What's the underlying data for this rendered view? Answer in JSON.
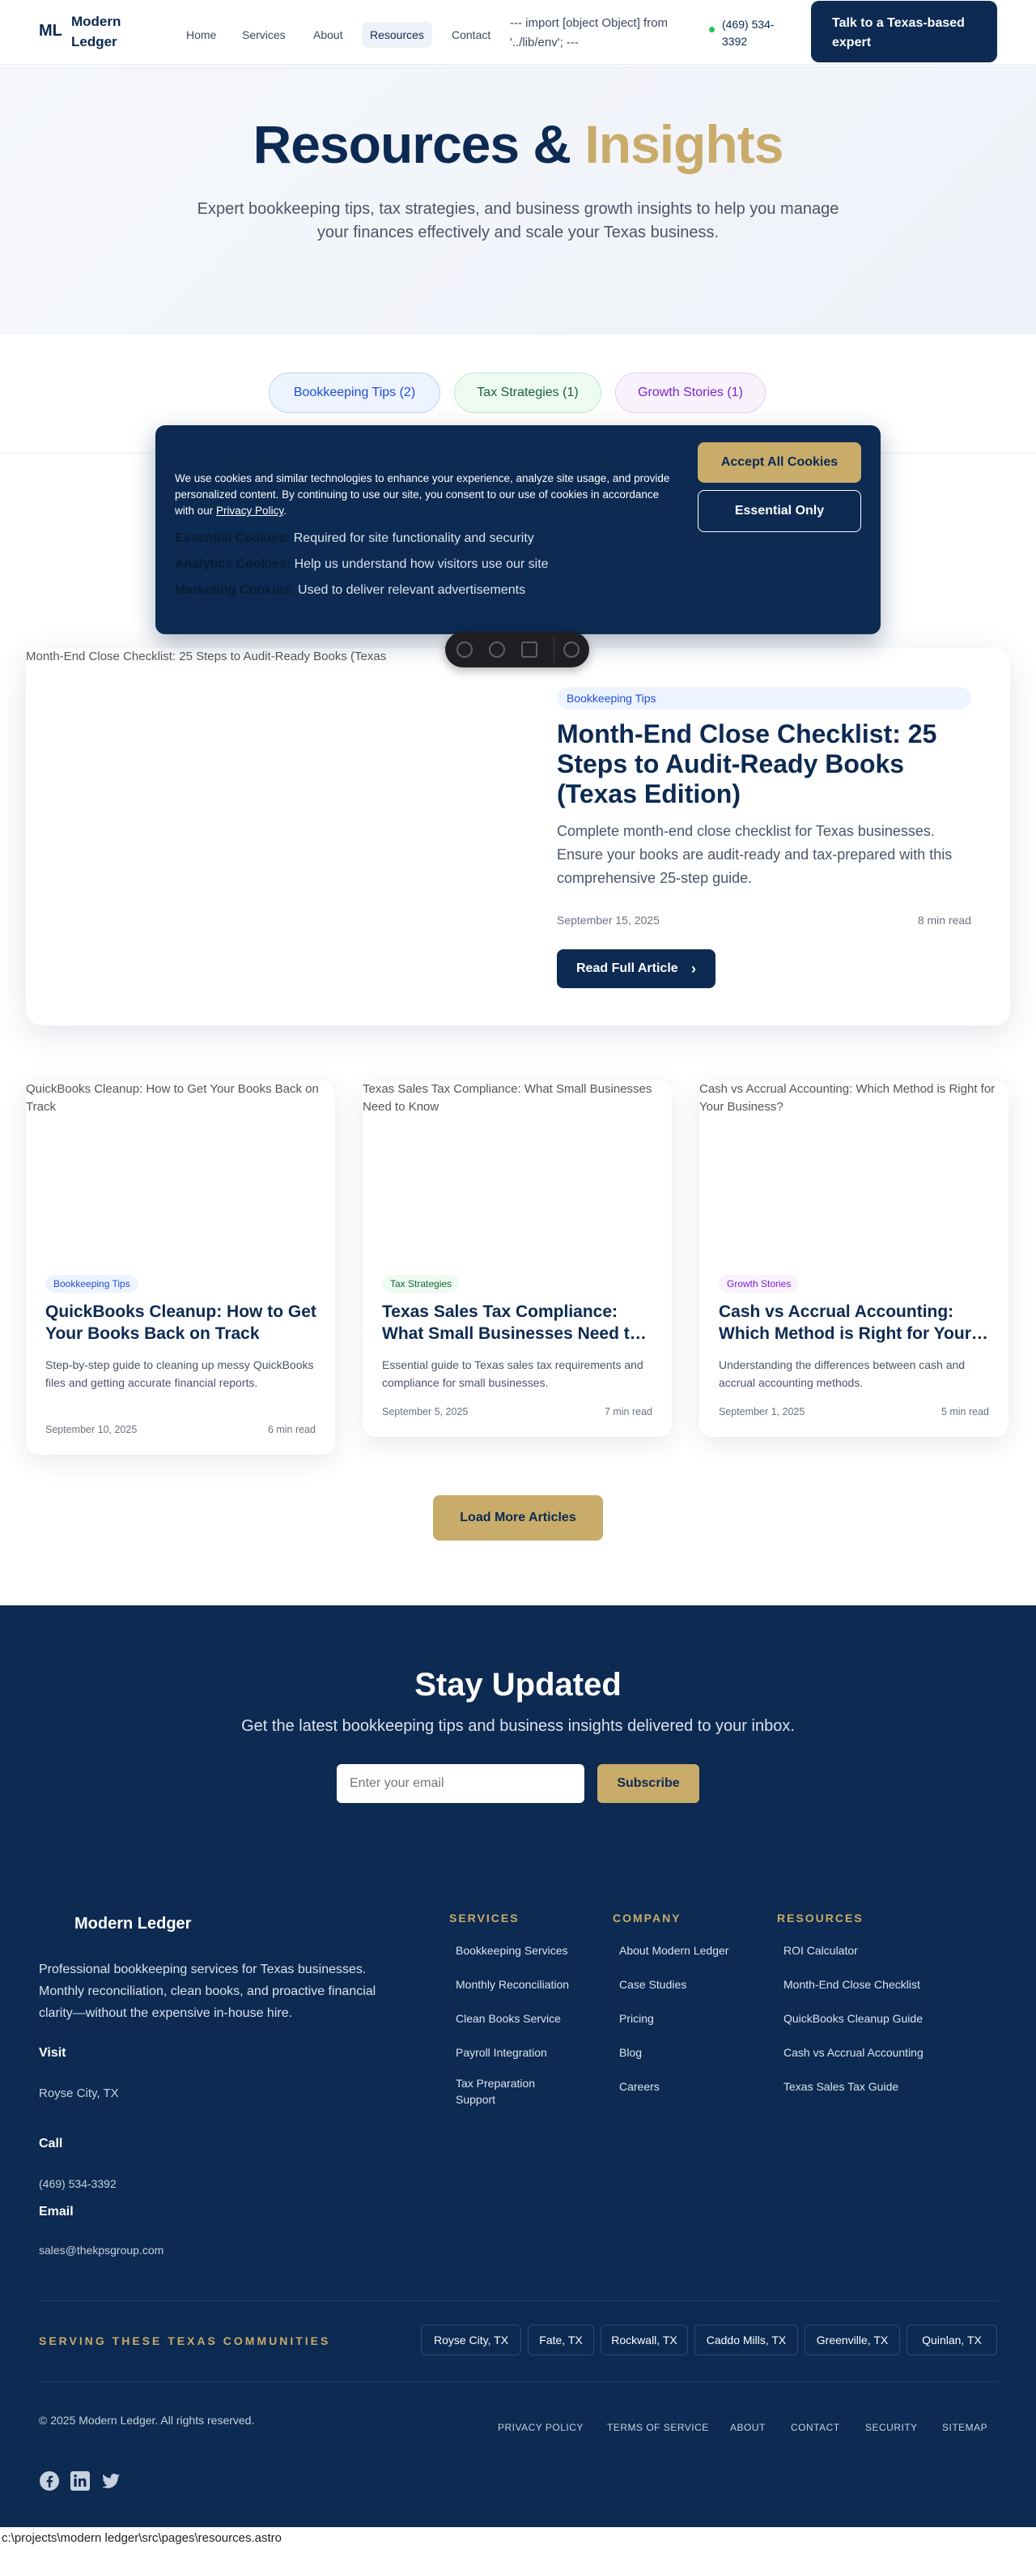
{
  "header": {
    "logo_mark": "ML",
    "logo_name": "Modern Ledger",
    "nav": [
      "Home",
      "Services",
      "About",
      "Resources",
      "Contact"
    ],
    "active_nav": "Resources",
    "env_text": "--- import [object Object] from '../lib/env'; ---",
    "phone": "(469) 534-3392",
    "cta": "Talk to a Texas-based expert"
  },
  "hero": {
    "title_main": "Resources &",
    "title_accent": "Insights",
    "subtitle": "Expert bookkeeping tips, tax strategies, and business growth insights to help you manage your finances effectively and scale your Texas business."
  },
  "filters": [
    "Bookkeeping Tips (2)",
    "Tax Strategies (1)",
    "Growth Stories (1)"
  ],
  "cookie": {
    "text": "We use cookies and similar technologies to enhance your experience, analyze site usage, and provide personalized content. By continuing to use our site, you consent to our use of cookies in accordance with our",
    "policy_link": "Privacy Policy",
    "rows": [
      {
        "label": "Essential Cookies:",
        "desc": "Required for site functionality and security"
      },
      {
        "label": "Analytics Cookies:",
        "desc": "Help us understand how visitors use our site"
      },
      {
        "label": "Marketing Cookies:",
        "desc": "Used to deliver relevant advertisements"
      }
    ],
    "accept": "Accept All Cookies",
    "essential": "Essential Only"
  },
  "featured": {
    "image_alt": "Month-End Close Checklist: 25 Steps to Audit-Ready Books (Texas",
    "category": "Bookkeeping Tips",
    "title": "Month-End Close Checklist: 25 Steps to Audit-Ready Books (Texas Edition)",
    "description": "Complete month-end close checklist for Texas businesses. Ensure your books are audit-ready and tax-prepared with this comprehensive 25-step guide.",
    "date": "September 15, 2025",
    "read_time": "8 min read",
    "button": "Read Full Article"
  },
  "articles": [
    {
      "image_alt": "QuickBooks Cleanup: How to Get Your Books Back on Track",
      "category": "Bookkeeping Tips",
      "title": "QuickBooks Cleanup: How to Get Your Books Back on Track",
      "description": "Step-by-step guide to cleaning up messy QuickBooks files and getting accurate financial reports.",
      "date": "September 10, 2025",
      "read_time": "6 min read"
    },
    {
      "image_alt": "Texas Sales Tax Compliance: What Small Businesses Need to Know",
      "category": "Tax Strategies",
      "title": "Texas Sales Tax Compliance: What Small Businesses Need t…",
      "description": "Essential guide to Texas sales tax requirements and compliance for small businesses.",
      "date": "September 5, 2025",
      "read_time": "7 min read"
    },
    {
      "image_alt": "Cash vs Accrual Accounting: Which Method is Right for Your Business?",
      "category": "Growth Stories",
      "title": "Cash vs Accrual Accounting: Which Method is Right for Your…",
      "description": "Understanding the differences between cash and accrual accounting methods.",
      "date": "September 1, 2025",
      "read_time": "5 min read"
    }
  ],
  "load_more": "Load More Articles",
  "newsletter": {
    "title": "Stay Updated",
    "subtitle": "Get the latest bookkeeping tips and business insights delivered to your inbox.",
    "placeholder": "Enter your email",
    "button": "Subscribe"
  },
  "footer": {
    "logo_name": "Modern Ledger",
    "description": "Professional bookkeeping services for Texas businesses. Monthly reconciliation, clean books, and proactive financial clarity—without the expensive in-house hire.",
    "visit_label": "Visit",
    "visit_value": "Royse City, TX",
    "call_label": "Call",
    "call_value": "(469) 534-3392",
    "email_label": "Email",
    "email_value": "sales@thekpsgroup.com",
    "columns": [
      {
        "heading": "SERVICES",
        "links": [
          "Bookkeeping Services",
          "Monthly Reconciliation",
          "Clean Books Service",
          "Payroll Integration",
          "Tax Preparation Support"
        ]
      },
      {
        "heading": "COMPANY",
        "links": [
          "About Modern Ledger",
          "Case Studies",
          "Pricing",
          "Blog",
          "Careers"
        ]
      },
      {
        "heading": "RESOURCES",
        "links": [
          "ROI Calculator",
          "Month-End Close Checklist",
          "QuickBooks Cleanup Guide",
          "Cash vs Accrual Accounting",
          "Texas Sales Tax Guide"
        ]
      }
    ],
    "serving_heading": "SERVING THESE TEXAS COMMUNITIES",
    "communities": [
      "Royse City, TX",
      "Fate, TX",
      "Rockwall, TX",
      "Caddo Mills, TX",
      "Greenville, TX",
      "Quinlan, TX"
    ],
    "copyright": "© 2025 Modern Ledger. All rights reserved.",
    "bottom_links": [
      "PRIVACY POLICY",
      "TERMS OF SERVICE",
      "ABOUT",
      "CONTACT",
      "SECURITY",
      "SITEMAP"
    ],
    "social": [
      "facebook-icon",
      "linkedin-icon",
      "twitter-icon"
    ]
  },
  "file_path": "c:\\projects\\modern ledger\\src\\pages\\resources.astro",
  "colors": {
    "navy": "#0c2a52",
    "gold": "#c9ab6a",
    "phone_dot": "#22c55e"
  }
}
